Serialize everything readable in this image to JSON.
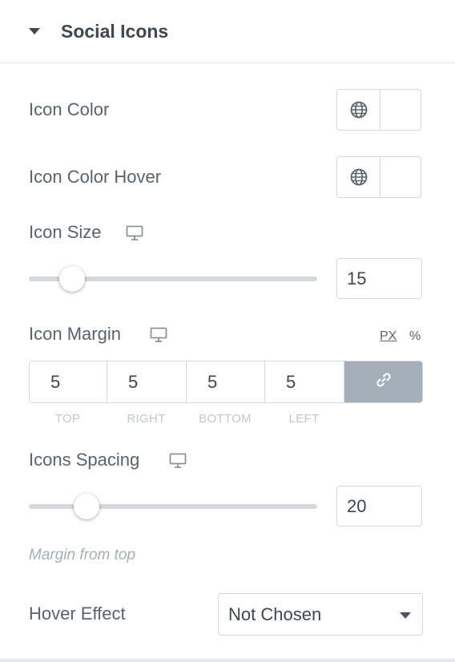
{
  "section": {
    "title": "Social Icons",
    "caret_icon": "caret-down-icon"
  },
  "icon_color": {
    "label": "Icon Color",
    "global_icon": "globe-icon",
    "value": ""
  },
  "icon_color_hover": {
    "label": "Icon Color Hover",
    "global_icon": "globe-icon",
    "value": ""
  },
  "icon_size": {
    "label": "Icon Size",
    "device_icon": "desktop-icon",
    "value": "15",
    "slider_fraction": 0.15
  },
  "icon_margin": {
    "label": "Icon Margin",
    "device_icon": "desktop-icon",
    "units": [
      "PX",
      "%"
    ],
    "active_unit": "PX",
    "fields": [
      {
        "label": "TOP",
        "value": "5"
      },
      {
        "label": "RIGHT",
        "value": "5"
      },
      {
        "label": "BOTTOM",
        "value": "5"
      },
      {
        "label": "LEFT",
        "value": "5"
      }
    ],
    "link_icon": "link-icon",
    "linked": true
  },
  "icons_spacing": {
    "label": "Icons Spacing",
    "device_icon": "desktop-icon",
    "value": "20",
    "slider_fraction": 0.2,
    "help_text": "Margin from top"
  },
  "hover_effect": {
    "label": "Hover Effect",
    "selected": "Not Chosen"
  },
  "colors": {
    "text": "#5a626c",
    "heading": "#3f4650",
    "border": "#d5d8dc",
    "link_button": "#a4afb7",
    "muted": "#c2c7cc"
  }
}
